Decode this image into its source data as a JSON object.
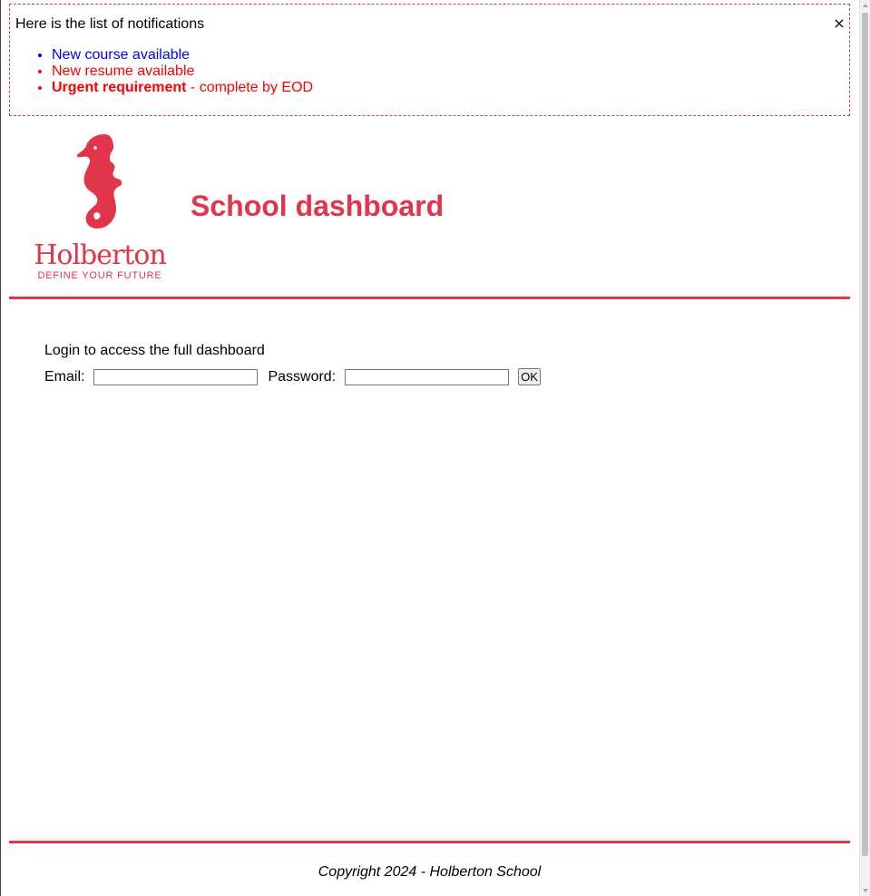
{
  "notifications": {
    "title": "Here is the list of notifications",
    "close_symbol": "×",
    "items": [
      {
        "text": "New course available",
        "type": "default"
      },
      {
        "text": "New resume available",
        "type": "urgent"
      },
      {
        "bold": "Urgent requirement",
        "rest": " - complete by EOD",
        "type": "urgent"
      }
    ]
  },
  "header": {
    "logo_name": "Holberton",
    "logo_tagline": "DEFINE YOUR FUTURE",
    "title": "School dashboard"
  },
  "login": {
    "intro": "Login to access the full dashboard",
    "email_label": "Email:",
    "email_value": "",
    "password_label": "Password:",
    "password_value": "",
    "submit_label": "OK"
  },
  "footer": {
    "copyright": "Copyright 2024 - Holberton School"
  },
  "colors": {
    "brand": "#e0354b",
    "notif_default": "#0000ff",
    "notif_urgent": "#ff0000"
  },
  "icons": {
    "logo": "seahorse-logo-icon",
    "close": "close-icon"
  }
}
